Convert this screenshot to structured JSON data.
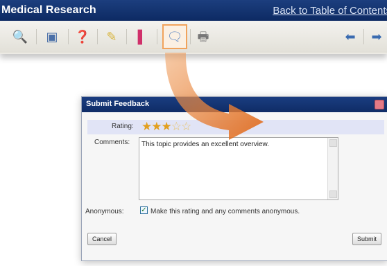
{
  "app": {
    "title": "Medical Research",
    "back_link": "Back to Table of Contents"
  },
  "toolbar": {
    "buttons": [
      {
        "icon": "search-doc-icon",
        "glyph": "🔍",
        "color": "#5a7fb5"
      },
      {
        "icon": "window-icon",
        "glyph": "▣",
        "color": "#4a6fa8"
      },
      {
        "icon": "help-icon",
        "glyph": "❓",
        "color": "#4a9a3a"
      },
      {
        "icon": "highlighter-icon",
        "glyph": "✎",
        "color": "#d8b43a"
      },
      {
        "icon": "bookmark-icon",
        "glyph": "▌",
        "color": "#d0306a"
      },
      {
        "icon": "feedback-icon",
        "glyph": "🗨",
        "color": "#5b86c4"
      },
      {
        "icon": "print-icon",
        "glyph": "🖶",
        "color": "#777777"
      },
      {
        "icon": "back-arrow-icon",
        "glyph": "⬅",
        "color": "#3a6bb0"
      },
      {
        "icon": "forward-arrow-icon",
        "glyph": "➡",
        "color": "#3a6bb0"
      }
    ]
  },
  "colors": {
    "title_bar": "#0d2a63",
    "arrow": "#e9823a",
    "rating_row": "#e1e4f6",
    "stars": "#e2a020"
  },
  "dialog": {
    "title": "Submit Feedback",
    "rating_label": "Rating:",
    "rating": 3,
    "rating_max": 5,
    "comments_label": "Comments:",
    "comments_value": "This topic provides an excellent overview.",
    "anonymous_label": "Anonymous:",
    "anonymous_checked": true,
    "anonymous_text": "Make this rating and any comments anonymous.",
    "cancel_label": "Cancel",
    "submit_label": "Submit"
  }
}
